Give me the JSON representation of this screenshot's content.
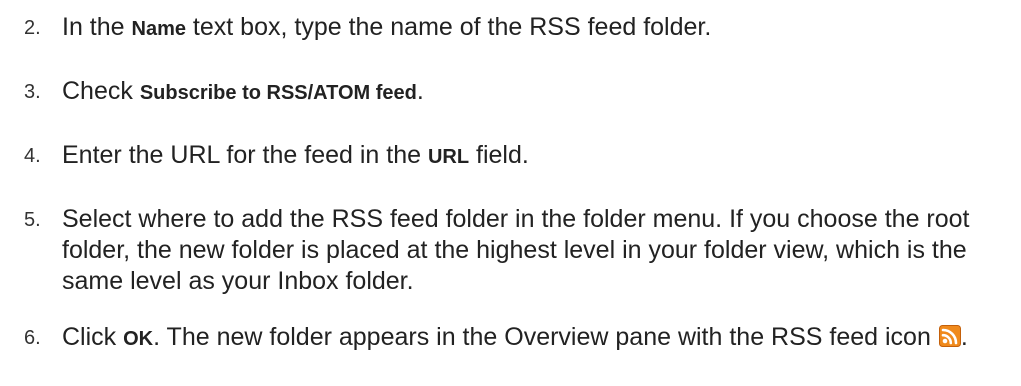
{
  "steps": [
    {
      "number": "2.",
      "parts": [
        {
          "text": "In the ",
          "bold": false
        },
        {
          "text": "Name",
          "bold": true
        },
        {
          "text": " text box, type the name of the RSS feed folder.",
          "bold": false
        }
      ]
    },
    {
      "number": "3.",
      "parts": [
        {
          "text": "Check ",
          "bold": false
        },
        {
          "text": "Subscribe to RSS/ATOM feed",
          "bold": true
        },
        {
          "text": ".",
          "bold": false
        }
      ]
    },
    {
      "number": "4.",
      "parts": [
        {
          "text": "Enter the URL for the feed in the ",
          "bold": false
        },
        {
          "text": "URL",
          "bold": true
        },
        {
          "text": " field.",
          "bold": false
        }
      ]
    },
    {
      "number": "5.",
      "parts": [
        {
          "text": "Select where to add the RSS feed folder in the folder menu. If you choose the root folder, the new folder is placed at the highest level in your folder view, which is the same level as your Inbox folder.",
          "bold": false
        }
      ]
    },
    {
      "number": "6.",
      "parts": [
        {
          "text": "Click ",
          "bold": false
        },
        {
          "text": "OK",
          "bold": true
        },
        {
          "text": ". The new folder appears in the Overview pane with the RSS feed icon ",
          "bold": false
        }
      ],
      "trailing_icon": "rss-feed-icon",
      "after_icon": "."
    }
  ],
  "colors": {
    "text": "#222222",
    "rss_icon_bg": "#f08a1c",
    "rss_icon_border": "#c4600a"
  }
}
